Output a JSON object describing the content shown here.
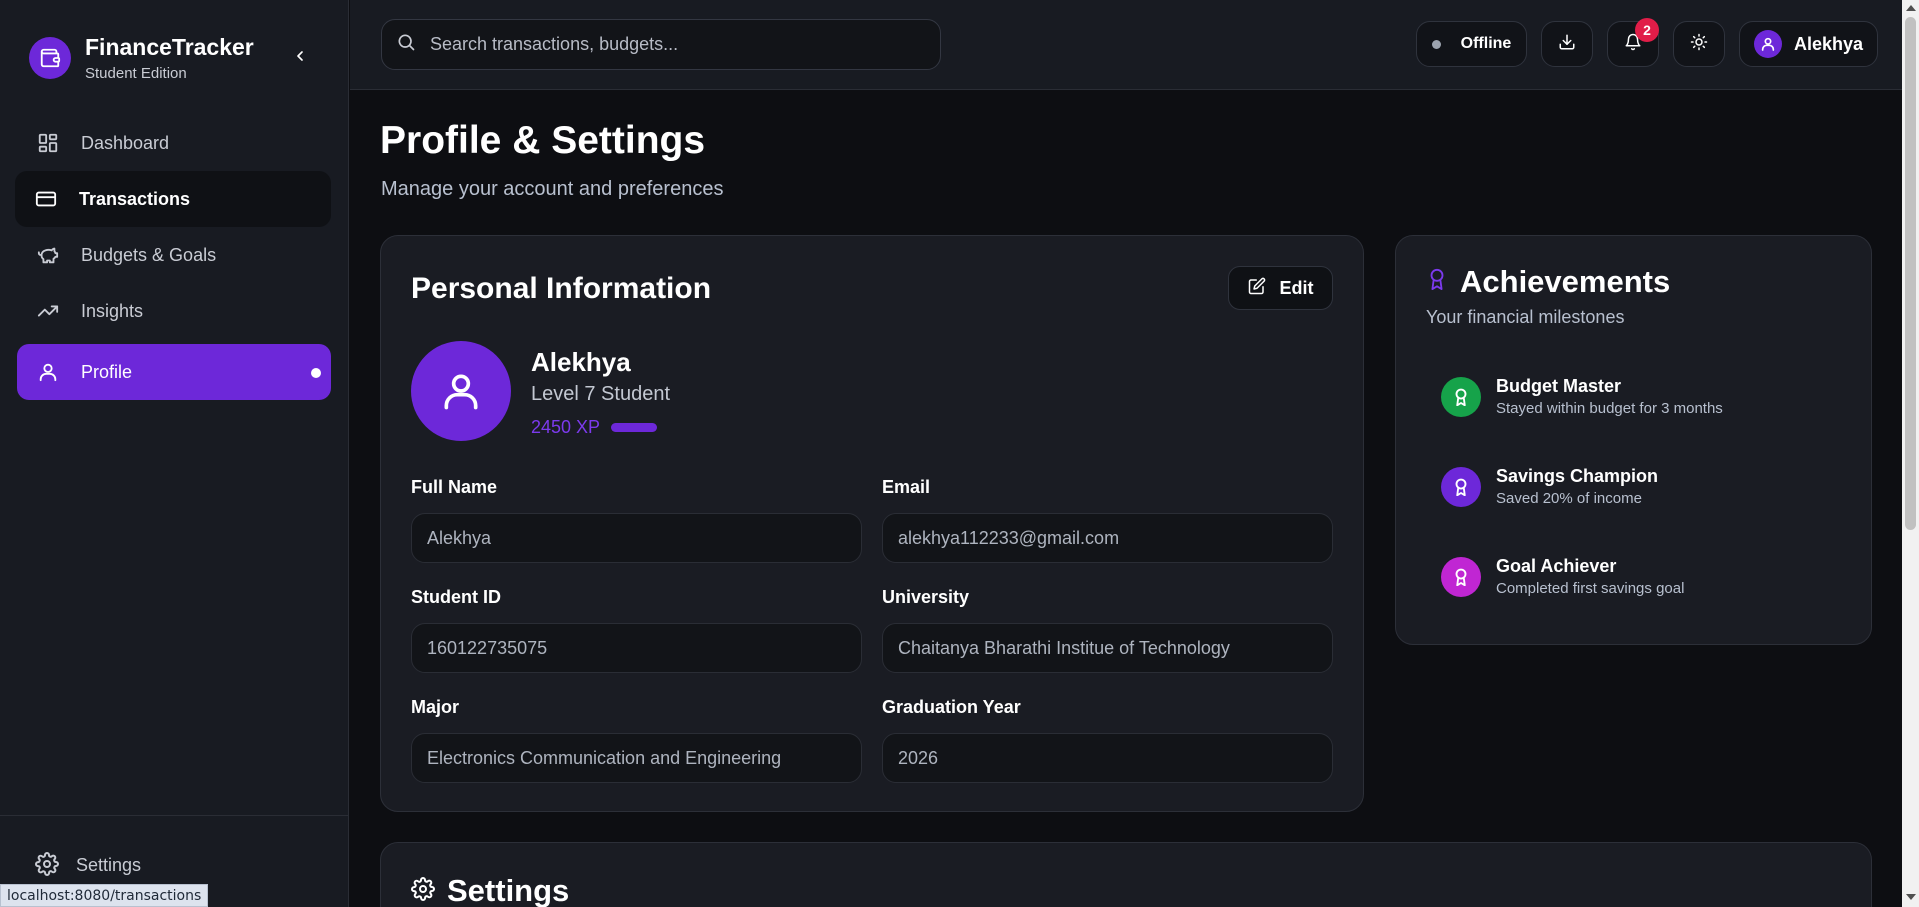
{
  "app": {
    "name": "FinanceTracker",
    "edition": "Student Edition"
  },
  "sidebar": {
    "items": [
      {
        "label": "Dashboard",
        "icon": "dashboard-icon"
      },
      {
        "label": "Transactions",
        "icon": "card-icon"
      },
      {
        "label": "Budgets & Goals",
        "icon": "piggy-bank-icon"
      },
      {
        "label": "Insights",
        "icon": "trending-up-icon"
      },
      {
        "label": "Profile",
        "icon": "user-icon"
      }
    ],
    "footer_label": "Settings"
  },
  "status_url": "localhost:8080/transactions",
  "topbar": {
    "search_placeholder": "Search transactions, budgets...",
    "status": "Offline",
    "notification_count": "2",
    "user_name": "Alekhya"
  },
  "page": {
    "title": "Profile & Settings",
    "subtitle": "Manage your account and preferences"
  },
  "personal": {
    "title": "Personal Information",
    "edit_label": "Edit",
    "name": "Alekhya",
    "level": "Level 7 Student",
    "xp": "2450 XP",
    "fields": [
      {
        "label": "Full Name",
        "value": "Alekhya"
      },
      {
        "label": "Email",
        "value": "alekhya112233@gmail.com"
      },
      {
        "label": "Student ID",
        "value": "160122735075"
      },
      {
        "label": "University",
        "value": "Chaitanya Bharathi Institue of Technology"
      },
      {
        "label": "Major",
        "value": "Electronics Communication and Engineering"
      },
      {
        "label": "Graduation Year",
        "value": "2026"
      }
    ]
  },
  "achievements": {
    "title": "Achievements",
    "subtitle": "Your financial milestones",
    "items": [
      {
        "name": "Budget Master",
        "desc": "Stayed within budget for 3 months",
        "color": "#16a34a"
      },
      {
        "name": "Savings Champion",
        "desc": "Saved 20% of income",
        "color": "#6d28d9"
      },
      {
        "name": "Goal Achiever",
        "desc": "Completed first savings goal",
        "color": "#c026d3"
      }
    ]
  },
  "settings_section": {
    "title": "Settings"
  },
  "colors": {
    "accent": "#6d28d9",
    "badge": "#e11d48"
  }
}
